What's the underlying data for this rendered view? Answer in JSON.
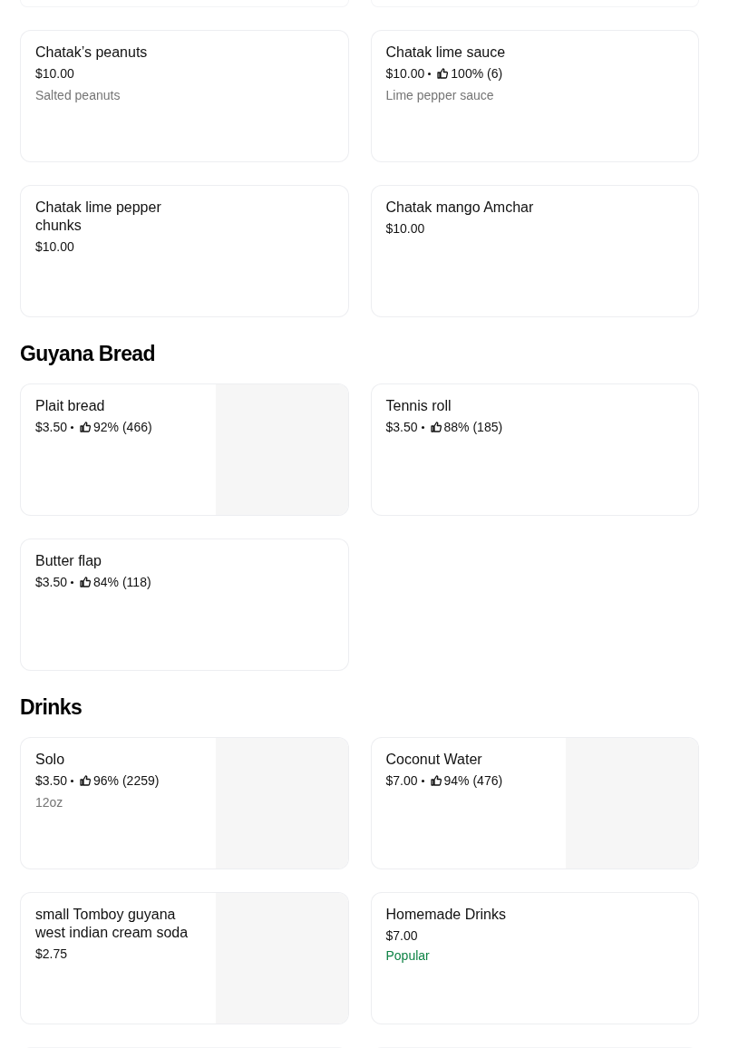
{
  "sections": [
    {
      "items": [
        {
          "name": "Chatak’s peanuts",
          "price": "$10.00",
          "description": "Salted peanuts"
        },
        {
          "name": "Chatak lime sauce",
          "price": "$10.00",
          "rating": "100% (6)",
          "description": "Lime pepper sauce"
        },
        {
          "name": "Chatak lime pepper chunks",
          "price": "$10.00"
        },
        {
          "name": "Chatak mango Amchar",
          "price": "$10.00"
        }
      ]
    },
    {
      "title": "Guyana Bread",
      "items": [
        {
          "name": "Plait bread",
          "price": "$3.50",
          "rating": "92% (466)",
          "image": {
            "kind": "placeholder"
          }
        },
        {
          "name": "Tennis roll",
          "price": "$3.50",
          "rating": "88% (185)"
        },
        {
          "name": "Butter flap",
          "price": "$3.50",
          "rating": "84% (118)"
        }
      ]
    },
    {
      "title": "Drinks",
      "items": [
        {
          "name": "Solo",
          "price": "$3.50",
          "rating": "96% (2259)",
          "description": "12oz",
          "image": {
            "kind": "placeholder"
          }
        },
        {
          "name": "Coconut Water",
          "price": "$7.00",
          "rating": "94% (476)",
          "image": {
            "kind": "placeholder"
          }
        },
        {
          "name": "small Tomboy guyana west indian cream soda",
          "price": "$2.75",
          "image": {
            "kind": "placeholder"
          }
        },
        {
          "name": "Homemade Drinks",
          "price": "$7.00",
          "badge": "Popular"
        }
      ]
    }
  ]
}
